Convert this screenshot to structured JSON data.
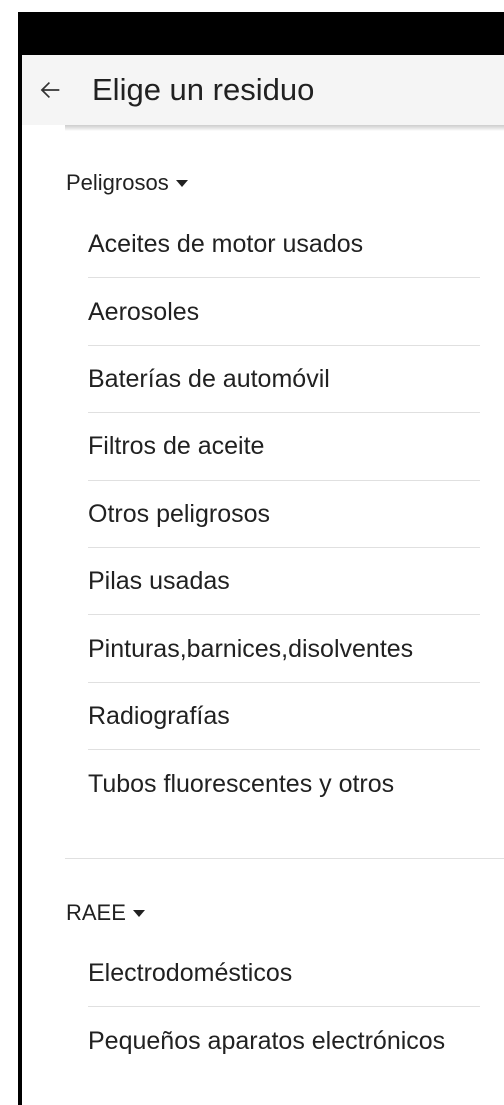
{
  "app_bar": {
    "title": "Elige un residuo",
    "back_icon": "arrow-back-icon"
  },
  "sections": [
    {
      "title": "Peligrosos",
      "expand_icon": "caret-down-icon",
      "items": [
        "Aceites de motor usados",
        "Aerosoles",
        "Baterías de automóvil",
        "Filtros de aceite",
        "Otros peligrosos",
        "Pilas usadas",
        "Pinturas,barnices,disolventes",
        "Radiografías",
        "Tubos fluorescentes y otros"
      ]
    },
    {
      "title": "RAEE",
      "expand_icon": "caret-down-icon",
      "items": [
        "Electrodomésticos",
        "Pequeños aparatos electrónicos"
      ]
    }
  ],
  "colors": {
    "status_bar": "#000000",
    "app_bar_background": "#f5f5f5",
    "text": "#212121",
    "divider": "#e0e0e0",
    "background": "#ffffff"
  }
}
